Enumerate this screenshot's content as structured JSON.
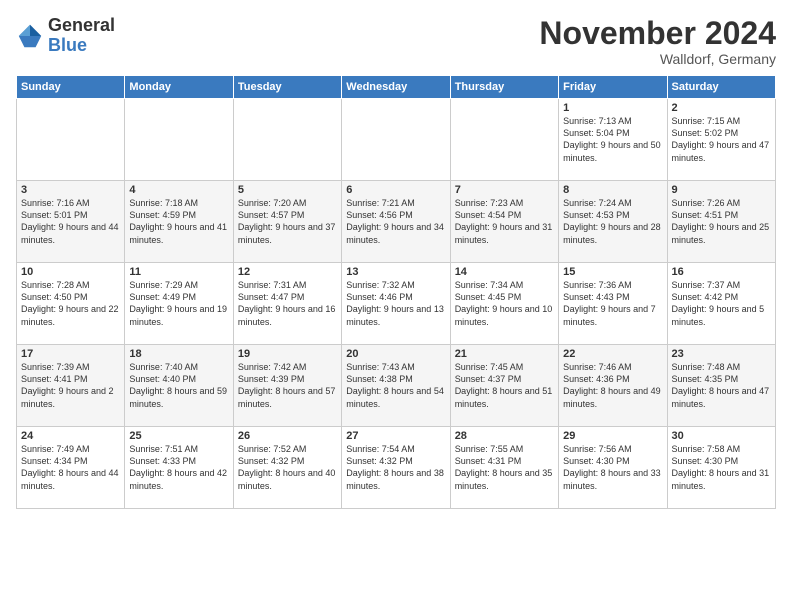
{
  "logo": {
    "general": "General",
    "blue": "Blue"
  },
  "header": {
    "month": "November 2024",
    "location": "Walldorf, Germany"
  },
  "weekdays": [
    "Sunday",
    "Monday",
    "Tuesday",
    "Wednesday",
    "Thursday",
    "Friday",
    "Saturday"
  ],
  "weeks": [
    [
      {
        "day": "",
        "info": ""
      },
      {
        "day": "",
        "info": ""
      },
      {
        "day": "",
        "info": ""
      },
      {
        "day": "",
        "info": ""
      },
      {
        "day": "",
        "info": ""
      },
      {
        "day": "1",
        "info": "Sunrise: 7:13 AM\nSunset: 5:04 PM\nDaylight: 9 hours and 50 minutes."
      },
      {
        "day": "2",
        "info": "Sunrise: 7:15 AM\nSunset: 5:02 PM\nDaylight: 9 hours and 47 minutes."
      }
    ],
    [
      {
        "day": "3",
        "info": "Sunrise: 7:16 AM\nSunset: 5:01 PM\nDaylight: 9 hours and 44 minutes."
      },
      {
        "day": "4",
        "info": "Sunrise: 7:18 AM\nSunset: 4:59 PM\nDaylight: 9 hours and 41 minutes."
      },
      {
        "day": "5",
        "info": "Sunrise: 7:20 AM\nSunset: 4:57 PM\nDaylight: 9 hours and 37 minutes."
      },
      {
        "day": "6",
        "info": "Sunrise: 7:21 AM\nSunset: 4:56 PM\nDaylight: 9 hours and 34 minutes."
      },
      {
        "day": "7",
        "info": "Sunrise: 7:23 AM\nSunset: 4:54 PM\nDaylight: 9 hours and 31 minutes."
      },
      {
        "day": "8",
        "info": "Sunrise: 7:24 AM\nSunset: 4:53 PM\nDaylight: 9 hours and 28 minutes."
      },
      {
        "day": "9",
        "info": "Sunrise: 7:26 AM\nSunset: 4:51 PM\nDaylight: 9 hours and 25 minutes."
      }
    ],
    [
      {
        "day": "10",
        "info": "Sunrise: 7:28 AM\nSunset: 4:50 PM\nDaylight: 9 hours and 22 minutes."
      },
      {
        "day": "11",
        "info": "Sunrise: 7:29 AM\nSunset: 4:49 PM\nDaylight: 9 hours and 19 minutes."
      },
      {
        "day": "12",
        "info": "Sunrise: 7:31 AM\nSunset: 4:47 PM\nDaylight: 9 hours and 16 minutes."
      },
      {
        "day": "13",
        "info": "Sunrise: 7:32 AM\nSunset: 4:46 PM\nDaylight: 9 hours and 13 minutes."
      },
      {
        "day": "14",
        "info": "Sunrise: 7:34 AM\nSunset: 4:45 PM\nDaylight: 9 hours and 10 minutes."
      },
      {
        "day": "15",
        "info": "Sunrise: 7:36 AM\nSunset: 4:43 PM\nDaylight: 9 hours and 7 minutes."
      },
      {
        "day": "16",
        "info": "Sunrise: 7:37 AM\nSunset: 4:42 PM\nDaylight: 9 hours and 5 minutes."
      }
    ],
    [
      {
        "day": "17",
        "info": "Sunrise: 7:39 AM\nSunset: 4:41 PM\nDaylight: 9 hours and 2 minutes."
      },
      {
        "day": "18",
        "info": "Sunrise: 7:40 AM\nSunset: 4:40 PM\nDaylight: 8 hours and 59 minutes."
      },
      {
        "day": "19",
        "info": "Sunrise: 7:42 AM\nSunset: 4:39 PM\nDaylight: 8 hours and 57 minutes."
      },
      {
        "day": "20",
        "info": "Sunrise: 7:43 AM\nSunset: 4:38 PM\nDaylight: 8 hours and 54 minutes."
      },
      {
        "day": "21",
        "info": "Sunrise: 7:45 AM\nSunset: 4:37 PM\nDaylight: 8 hours and 51 minutes."
      },
      {
        "day": "22",
        "info": "Sunrise: 7:46 AM\nSunset: 4:36 PM\nDaylight: 8 hours and 49 minutes."
      },
      {
        "day": "23",
        "info": "Sunrise: 7:48 AM\nSunset: 4:35 PM\nDaylight: 8 hours and 47 minutes."
      }
    ],
    [
      {
        "day": "24",
        "info": "Sunrise: 7:49 AM\nSunset: 4:34 PM\nDaylight: 8 hours and 44 minutes."
      },
      {
        "day": "25",
        "info": "Sunrise: 7:51 AM\nSunset: 4:33 PM\nDaylight: 8 hours and 42 minutes."
      },
      {
        "day": "26",
        "info": "Sunrise: 7:52 AM\nSunset: 4:32 PM\nDaylight: 8 hours and 40 minutes."
      },
      {
        "day": "27",
        "info": "Sunrise: 7:54 AM\nSunset: 4:32 PM\nDaylight: 8 hours and 38 minutes."
      },
      {
        "day": "28",
        "info": "Sunrise: 7:55 AM\nSunset: 4:31 PM\nDaylight: 8 hours and 35 minutes."
      },
      {
        "day": "29",
        "info": "Sunrise: 7:56 AM\nSunset: 4:30 PM\nDaylight: 8 hours and 33 minutes."
      },
      {
        "day": "30",
        "info": "Sunrise: 7:58 AM\nSunset: 4:30 PM\nDaylight: 8 hours and 31 minutes."
      }
    ]
  ]
}
